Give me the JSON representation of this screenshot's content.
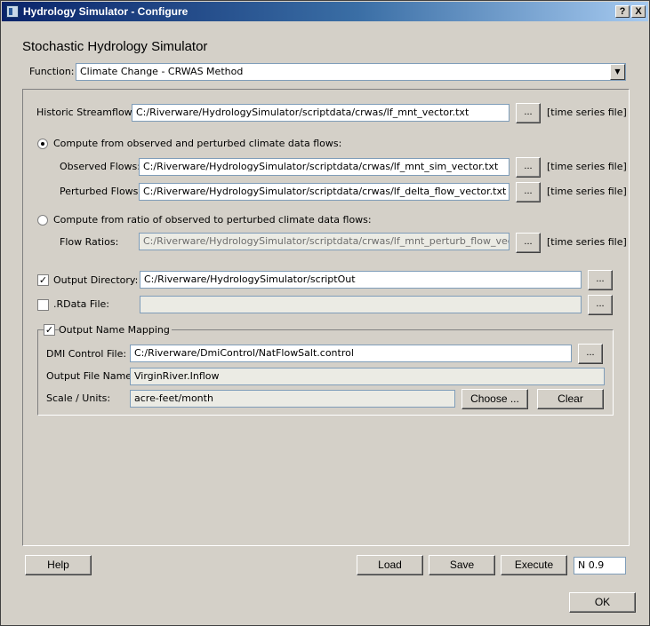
{
  "window": {
    "title": "Hydrology Simulator - Configure",
    "help_btn": "?",
    "close_btn": "X"
  },
  "heading": "Stochastic Hydrology Simulator",
  "function": {
    "label": "Function:",
    "value": "Climate Change - CRWAS Method"
  },
  "historic": {
    "label": "Historic Streamflows:",
    "value": "C:/Riverware/HydrologySimulator/scriptdata/crwas/lf_mnt_vector.txt",
    "hint": "[time series file]"
  },
  "option_perturbed": {
    "label": "Compute from observed and perturbed climate data flows:",
    "selected": true,
    "observed": {
      "label": "Observed Flows:",
      "value": "C:/Riverware/HydrologySimulator/scriptdata/crwas/lf_mnt_sim_vector.txt",
      "hint": "[time series file]"
    },
    "perturbed": {
      "label": "Perturbed Flows:",
      "value": "C:/Riverware/HydrologySimulator/scriptdata/crwas/lf_delta_flow_vector.txt",
      "hint": "[time series file]"
    }
  },
  "option_ratio": {
    "label": "Compute from ratio of observed to perturbed climate data flows:",
    "selected": false,
    "ratios": {
      "label": "Flow Ratios:",
      "value": "C:/Riverware/HydrologySimulator/scriptdata/crwas/lf_mnt_perturb_flow_vector.txt",
      "hint": "[time series file]"
    }
  },
  "output_dir": {
    "label": "Output Directory:",
    "checked": true,
    "value": "C:/Riverware/HydrologySimulator/scriptOut"
  },
  "rdata": {
    "label": ".RData File:",
    "checked": false,
    "value": ""
  },
  "mapping": {
    "label": "Output Name Mapping",
    "checked": true,
    "dmi": {
      "label": "DMI Control File:",
      "value": "C:/Riverware/DmiControl/NatFlowSalt.control"
    },
    "out_name": {
      "label": "Output File Name:",
      "value": "VirginRiver.Inflow"
    },
    "scale": {
      "label": "Scale / Units:",
      "value": "acre-feet/month"
    },
    "choose_label": "Choose ...",
    "clear_label": "Clear"
  },
  "browse_label": "...",
  "check_mark": "✓",
  "combo_arrow": "▼",
  "footer": {
    "help": "Help",
    "load": "Load",
    "save": "Save",
    "execute": "Execute",
    "param": "N 0.9",
    "ok": "OK"
  }
}
